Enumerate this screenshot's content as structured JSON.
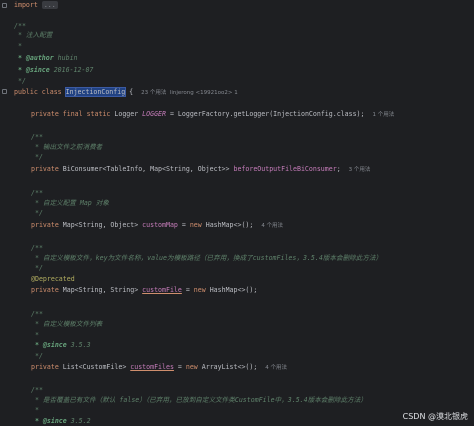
{
  "editor": {
    "l_import_kw": "import",
    "l_import_fold": "...",
    "l_doc_open": "/**",
    "l_doc_desc": " * 注入配置",
    "l_doc_star": " *",
    "l_author_tag": " * @author",
    "l_author_val": " hubin",
    "l_since_tag": " * @since",
    "l_since_val": " 2016-12-07",
    "l_doc_close": " */",
    "class_public": "public",
    "class_class": " class ",
    "class_name": "InjectionConfig",
    "class_brace": " {",
    "class_hint": "23 个用法  linjerong <19921oo2> 1",
    "logger_kw": "private final static",
    "logger_type": " Logger ",
    "logger_const": "LOGGER",
    "logger_rest": " = LoggerFactory.getLogger(InjectionConfig.class);",
    "logger_hint": "1 个用法",
    "bi_doc_open": "/**",
    "bi_doc_desc": " * 输出文件之前消费者",
    "bi_doc_close": " */",
    "bi_kw": "private",
    "bi_type": " BiConsumer<TableInfo, Map<String, Object>> ",
    "bi_name": "beforeOutputFileBiConsumer",
    "bi_end": ";",
    "bi_hint": "3 个用法",
    "map_doc_open": "/**",
    "map_doc_desc": " * 自定义配置 Map 对象",
    "map_doc_close": " */",
    "map_kw": "private",
    "map_type": " Map<String, Object> ",
    "map_name": "customMap",
    "map_eq": " = ",
    "map_new": "new",
    "map_rest": " HashMap<>();",
    "map_hint": "4 个用法",
    "cf_doc_open": "/**",
    "cf_doc_desc": " * 自定义模板文件，key为文件名称，value为模板路径（已弃用，換成了customFiles，3.5.4版本会删除此方法）",
    "cf_doc_close": " */",
    "cf_ann": "@Deprecated",
    "cf_kw": "private",
    "cf_type": " Map<String, String> ",
    "cf_name": "customFile",
    "cf_eq": " = ",
    "cf_new": "new",
    "cf_rest": " HashMap<>();",
    "cfs_doc_open": "/**",
    "cfs_doc_desc": " * 自定义模板文件列表",
    "cfs_doc_star": " *",
    "cfs_since_tag": " * @since",
    "cfs_since_val": " 3.5.3",
    "cfs_doc_close": " */",
    "cfs_kw": "private",
    "cfs_type": " List<CustomFile> ",
    "cfs_name": "customFiles",
    "cfs_eq": " = ",
    "cfs_new": "new",
    "cfs_rest": " ArrayList<>();",
    "cfs_hint": "4 个用法",
    "ow_doc_open": "/**",
    "ow_doc_desc": " * 是否覆盖已有文件（默认 false）（已弃用，已放到自定义文件类CustomFile中，3.5.4版本会删除此方法）",
    "ow_doc_star": " *",
    "ow_since_tag": " * @since",
    "ow_since_val": " 3.5.2"
  },
  "watermark": "CSDN @漠北银虎"
}
